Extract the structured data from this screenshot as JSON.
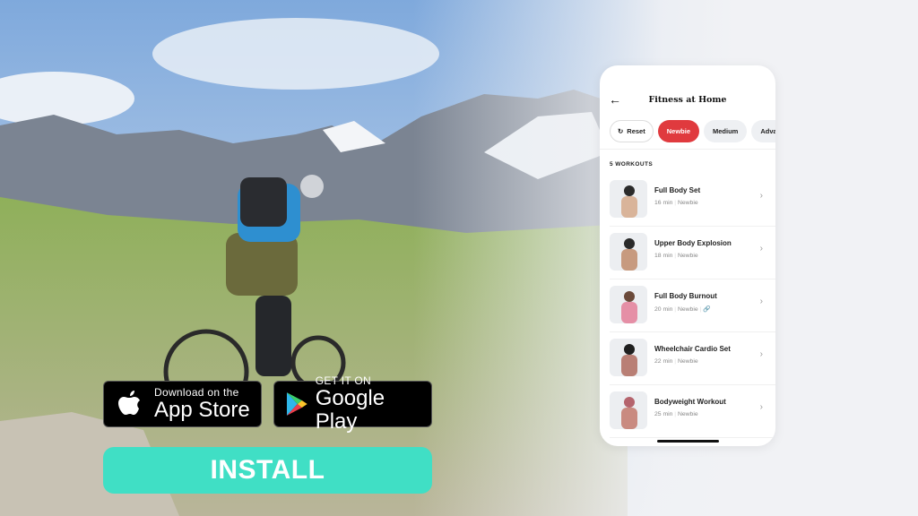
{
  "store_buttons": {
    "app_store": {
      "small": "Download on the",
      "big": "App Store",
      "icon": "apple-icon"
    },
    "google_play": {
      "small": "GET IT ON",
      "big": "Google Play",
      "icon": "google-play-icon"
    }
  },
  "install_label": "INSTALL",
  "colors": {
    "install": "#40dfc5",
    "active_chip": "#e03a3e"
  },
  "phone": {
    "back_icon": "arrow-left-icon",
    "title": "Fitness at Home",
    "chips": [
      {
        "label": "Reset",
        "icon": "refresh-icon"
      },
      {
        "label": "Newbie",
        "active": true
      },
      {
        "label": "Medium"
      },
      {
        "label": "Advance"
      }
    ],
    "count_label": "5 WORKOUTS",
    "workouts": [
      {
        "name": "Full Body Set",
        "duration": "16 min",
        "level": "Newbie"
      },
      {
        "name": "Upper Body Explosion",
        "duration": "18 min",
        "level": "Newbie"
      },
      {
        "name": "Full Body Burnout",
        "duration": "20 min",
        "level": "Newbie",
        "extra_icon": "link-icon"
      },
      {
        "name": "Wheelchair Cardio Set",
        "duration": "22 min",
        "level": "Newbie"
      },
      {
        "name": "Bodyweight Workout",
        "duration": "25 min",
        "level": "Newbie"
      }
    ]
  }
}
